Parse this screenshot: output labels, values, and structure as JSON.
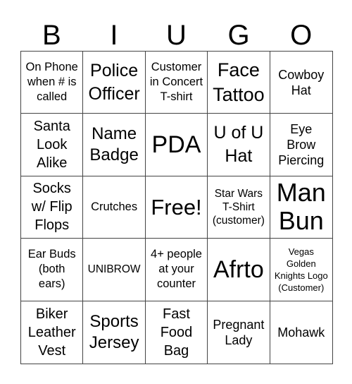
{
  "header": {
    "letters": [
      "B",
      "I",
      "U",
      "G",
      "O"
    ]
  },
  "grid": {
    "rows": [
      [
        "On Phone\nwhen # is\ncalled",
        "Police\nOfficer",
        "Customer\nin Concert\nT-shirt",
        "Face\nTattoo",
        "Cowboy\nHat"
      ],
      [
        "Santa\nLook\nAlike",
        "Name\nBadge",
        "PDA",
        "U of U\nHat",
        "Eye\nBrow\nPiercing"
      ],
      [
        "Socks\nw/ Flip\nFlops",
        "Crutches",
        "Free!",
        "Star Wars\nT-Shirt\n(customer)",
        "Man\nBun"
      ],
      [
        "Ear Buds\n(both\nears)",
        "UNIBROW",
        "4+ people\nat your\ncounter",
        "Afrto",
        "Vegas\nGolden\nKnights Logo\n(Customer)"
      ],
      [
        "Biker\nLeather\nVest",
        "Sports\nJersey",
        "Fast\nFood\nBag",
        "Pregnant\nLady",
        "Mohawk"
      ]
    ],
    "free_space": "Free!"
  }
}
